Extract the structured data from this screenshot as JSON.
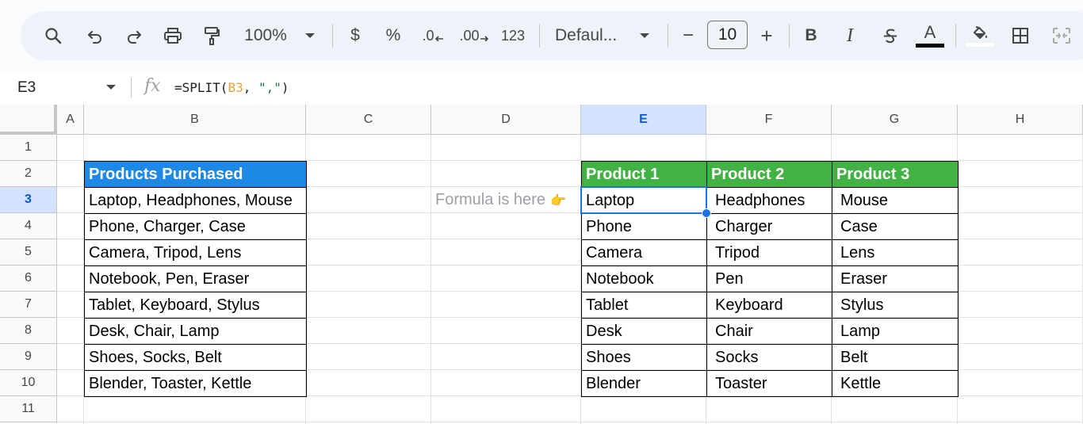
{
  "toolbar": {
    "zoom_label": "100%",
    "currency_label": "$",
    "percent_label": "%",
    "dec_decrease_label": ".0",
    "dec_increase_label": ".00",
    "number_format_label": "123",
    "font_label": "Defaul...",
    "font_size_value": "10",
    "minus_label": "−",
    "plus_label": "+",
    "bold_label": "B",
    "italic_label": "I",
    "text_color_label": "A",
    "icons": [
      "search-icon",
      "undo-icon",
      "redo-icon",
      "print-icon",
      "paint-format-icon",
      "zoom-dropdown-icon",
      "font-dropdown-icon",
      "strikethrough-icon",
      "fill-color-icon",
      "borders-icon",
      "merge-cells-icon"
    ]
  },
  "formula_bar": {
    "name_box": "E3",
    "fx_label": "fx",
    "formula_prefix": "=SPLIT(",
    "formula_ref": "B3",
    "formula_sep": ", ",
    "formula_str": "\",\"",
    "formula_suffix": ")"
  },
  "grid": {
    "columns": [
      "A",
      "B",
      "C",
      "D",
      "E",
      "F",
      "G",
      "H"
    ],
    "selected_column": "E",
    "rows": [
      "1",
      "2",
      "3",
      "4",
      "5",
      "6",
      "7",
      "8",
      "9",
      "10",
      "11"
    ],
    "selected_row": "3"
  },
  "source_table": {
    "header": "Products Purchased",
    "rows": [
      "Laptop, Headphones, Mouse",
      "Phone, Charger, Case",
      "Camera, Tripod, Lens",
      "Notebook, Pen, Eraser",
      "Tablet, Keyboard, Stylus",
      "Desk, Chair, Lamp",
      "Shoes, Socks, Belt",
      "Blender, Toaster, Kettle"
    ]
  },
  "note": {
    "text": "Formula is here",
    "emoji": "👉"
  },
  "result_table": {
    "headers": [
      "Product 1",
      "Product 2",
      "Product 3"
    ],
    "rows": [
      [
        "Laptop",
        "Headphones",
        "Mouse"
      ],
      [
        "Phone",
        "Charger",
        "Case"
      ],
      [
        "Camera",
        "Tripod",
        "Lens"
      ],
      [
        "Notebook",
        "Pen",
        "Eraser"
      ],
      [
        "Tablet",
        "Keyboard",
        "Stylus"
      ],
      [
        "Desk",
        "Chair",
        "Lamp"
      ],
      [
        "Shoes",
        "Socks",
        "Belt"
      ],
      [
        "Blender",
        "Toaster",
        "Kettle"
      ]
    ]
  },
  "colors": {
    "source_header_bg": "#1e88e5",
    "result_header_bg": "#43b244",
    "selection": "#1a73e8"
  }
}
